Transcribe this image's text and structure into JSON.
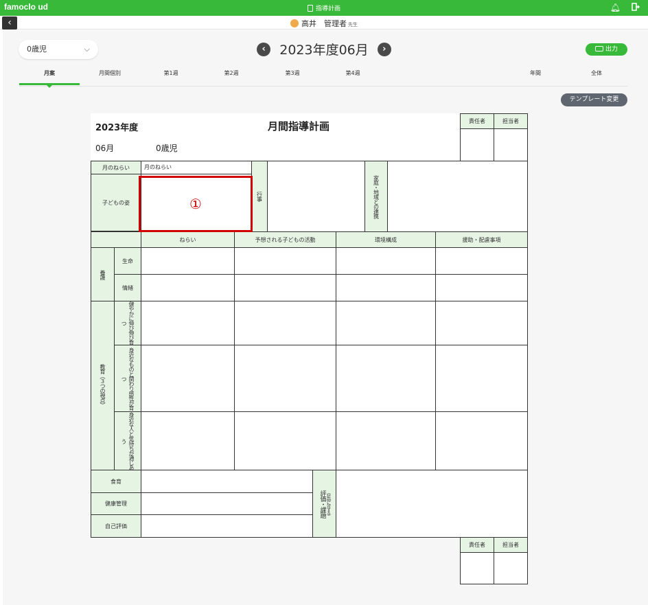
{
  "appbar": {
    "logo": "famoclo ud",
    "center_title": "指導計画"
  },
  "user": {
    "name": "高井　管理者",
    "honorific": "先生"
  },
  "filters": {
    "age_class": "0歳児",
    "period_title": "2023年度06月",
    "print_label": "出力"
  },
  "tabs": [
    {
      "label": "月案"
    },
    {
      "label": "月間個別"
    },
    {
      "label": "第1週"
    },
    {
      "label": "第2週"
    },
    {
      "label": "第3週"
    },
    {
      "label": "第4週"
    },
    {
      "label": "年間"
    },
    {
      "label": "全体"
    }
  ],
  "template_button": "テンプレート変更",
  "sheet": {
    "year": "2023年度",
    "title": "月間指導計画",
    "month": "06月",
    "age": "0歳児",
    "sign_top": [
      "責任者",
      "担当者"
    ],
    "sign_bottom": [
      "責任者",
      "担当者"
    ],
    "row_monthly_aim_label": "月のねらい",
    "row_monthly_aim_value": "月のねらい",
    "row_child_label": "子どもの姿",
    "events_label": "行事",
    "family_label": "家庭・地域との連携",
    "highlight_marker": "①",
    "col_headers": [
      "ねらい",
      "予想される子どもの活動",
      "環境構成",
      "援助・配慮事項"
    ],
    "nursing_label": "養護",
    "nursing_rows": [
      "生命",
      "情緒"
    ],
    "education_label": "教育（３つの視点）",
    "education_rows": [
      "健やかに伸び伸び育つ",
      "身近なものと関わり感性が育つ",
      "身近な人と気持ちが通じあう"
    ],
    "bottom_rows": [
      "食育",
      "健康管理",
      "自己評価"
    ],
    "evaluation_label": "評価・課題",
    "evaluation_sub": "（計画に対する）"
  }
}
